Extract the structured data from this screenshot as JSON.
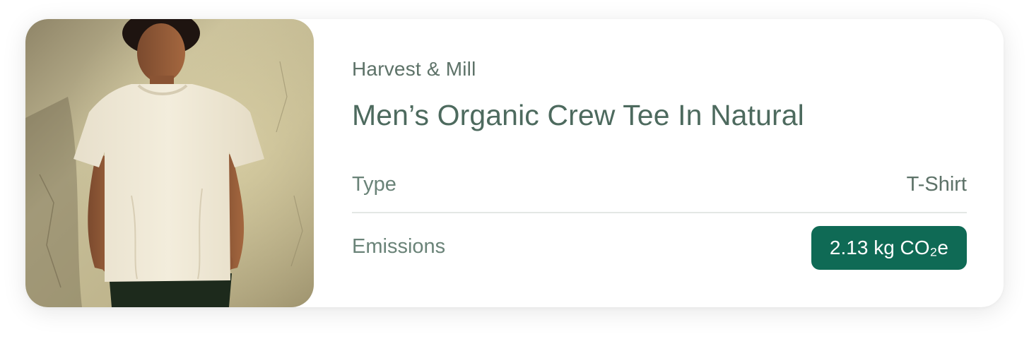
{
  "product": {
    "brand": "Harvest & Mill",
    "title": "Men’s Organic Crew Tee In Natural",
    "image": {
      "subject": "man-wearing-natural-crew-tee",
      "description_icon": "product-photo"
    }
  },
  "details": {
    "type_label": "Type",
    "type_value": "T-Shirt",
    "emissions_label": "Emissions",
    "emissions_value": "2.13 kg CO₂e"
  },
  "colors": {
    "text_primary": "#4d6a5e",
    "badge_background": "#0f6a55",
    "badge_text": "#ffffff",
    "divider": "#e4e7e5"
  }
}
